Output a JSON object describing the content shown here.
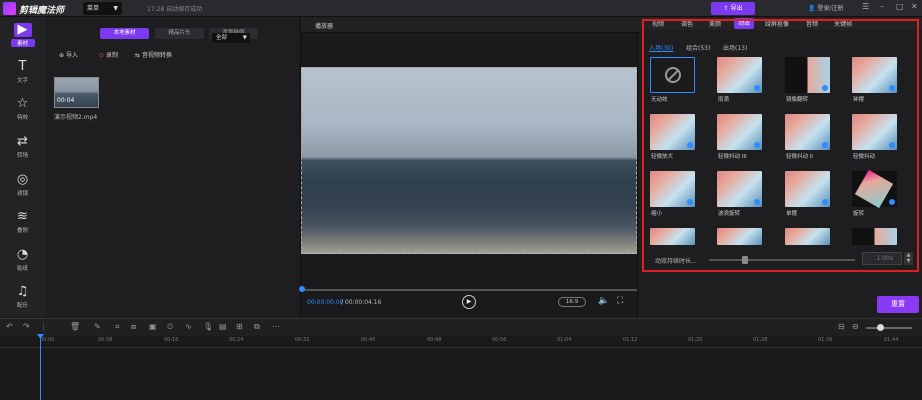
{
  "app": {
    "name": "剪辑魔法师",
    "menu_label": "菜单",
    "save_status": "17:28 自动保存成功",
    "export_label": "导出",
    "login_label": "登录/注册"
  },
  "leftbar": {
    "items": [
      {
        "label": "素材",
        "icon": "folder-icon"
      },
      {
        "label": "文字",
        "icon": "text-icon"
      },
      {
        "label": "特效",
        "icon": "sparkle-icon"
      },
      {
        "label": "转场",
        "icon": "transition-icon"
      },
      {
        "label": "滤镜",
        "icon": "filter-icon"
      },
      {
        "label": "叠附",
        "icon": "layers-icon"
      },
      {
        "label": "贴纸",
        "icon": "sticker-icon"
      },
      {
        "label": "配乐",
        "icon": "music-icon"
      }
    ]
  },
  "media": {
    "tabs": [
      "本地素材",
      "精品片头",
      "背景样例"
    ],
    "import_label": "导入",
    "record_label": "录制",
    "convert_label": "音视频转换",
    "filter_value": "全部",
    "clip": {
      "duration": "00:04",
      "name": "演示视频2.mp4"
    }
  },
  "player": {
    "title": "播放器",
    "current_time": "00:00:00.00",
    "total_time": "/ 00:00:04.16",
    "ratio": "16:9"
  },
  "right": {
    "tabs": [
      "视频",
      "调色",
      "美颜",
      "动效",
      "绿屏抠像",
      "音频",
      "关键帧"
    ],
    "active_tab": "动效",
    "subtabs": [
      "入场(30)",
      "组合(53)",
      "出场(13)"
    ],
    "animations": [
      "无动效",
      "雨滴",
      "镜像翻转",
      "钟摆",
      "轻微放大",
      "轻微抖动 III",
      "轻微抖动 II",
      "轻微抖动",
      "缩小",
      "波浪旋转",
      "单摆",
      "旋转"
    ],
    "duration_label": "动效持续时长...",
    "duration_value": "1.00s",
    "reset_label": "重置"
  },
  "timeline": {
    "ticks": [
      "00:00",
      "00:08",
      "00:16",
      "00:24",
      "00:32",
      "00:40",
      "00:48",
      "00:56",
      "01:04",
      "01:12",
      "01:20",
      "01:28",
      "01:36",
      "01:44"
    ]
  }
}
